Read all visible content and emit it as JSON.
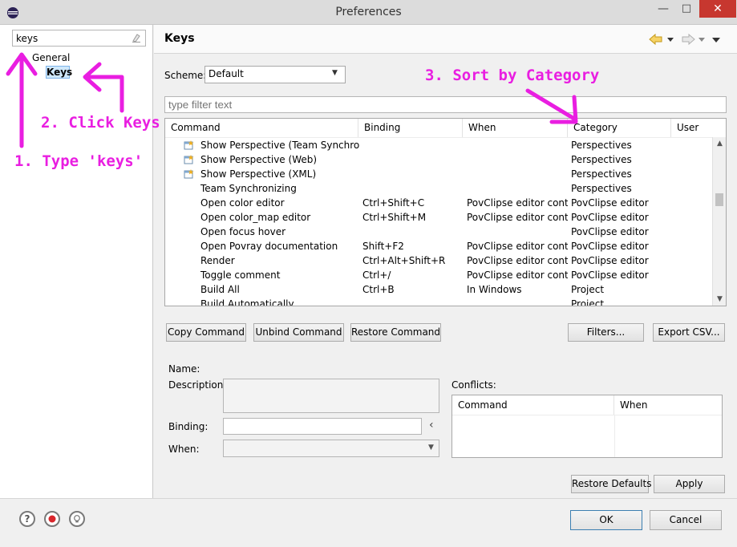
{
  "window": {
    "title": "Preferences",
    "minimize_glyph": "—",
    "maximize_glyph": "□",
    "close_glyph": "✕",
    "close_color": "#c7372f"
  },
  "nav": {
    "filter_value": "keys",
    "clear_icon": "clear-icon",
    "tree": {
      "general": "General",
      "keys": "Keys"
    }
  },
  "page": {
    "title": "Keys",
    "nav_icons": [
      "back-icon",
      "back-menu-icon",
      "forward-icon",
      "forward-menu-icon",
      "view-menu-icon"
    ]
  },
  "scheme": {
    "label": "Scheme:",
    "value": "Default"
  },
  "filter": {
    "placeholder": "type filter text"
  },
  "table": {
    "columns": [
      "Command",
      "Binding",
      "When",
      "Category",
      "User"
    ],
    "sort_indicator": "˄",
    "rows": [
      {
        "icon": true,
        "command": "Show Perspective (Team Synchronizing)",
        "binding": "",
        "when": "",
        "category": "Perspectives"
      },
      {
        "icon": true,
        "command": "Show Perspective (Web)",
        "binding": "",
        "when": "",
        "category": "Perspectives"
      },
      {
        "icon": true,
        "command": "Show Perspective (XML)",
        "binding": "",
        "when": "",
        "category": "Perspectives"
      },
      {
        "icon": false,
        "command": "Team Synchronizing",
        "binding": "",
        "when": "",
        "category": "Perspectives"
      },
      {
        "icon": false,
        "command": "Open color editor",
        "binding": "Ctrl+Shift+C",
        "when": "PovClipse editor context",
        "category": "PovClipse editor"
      },
      {
        "icon": false,
        "command": "Open color_map editor",
        "binding": "Ctrl+Shift+M",
        "when": "PovClipse editor context",
        "category": "PovClipse editor"
      },
      {
        "icon": false,
        "command": "Open focus hover",
        "binding": "",
        "when": "",
        "category": "PovClipse editor"
      },
      {
        "icon": false,
        "command": "Open Povray documentation",
        "binding": "Shift+F2",
        "when": "PovClipse editor context",
        "category": "PovClipse editor"
      },
      {
        "icon": false,
        "command": "Render",
        "binding": "Ctrl+Alt+Shift+R",
        "when": "PovClipse editor context",
        "category": "PovClipse editor"
      },
      {
        "icon": false,
        "command": "Toggle comment",
        "binding": "Ctrl+/",
        "when": "PovClipse editor context",
        "category": "PovClipse editor"
      },
      {
        "icon": false,
        "command": "Build All",
        "binding": "Ctrl+B",
        "when": "In Windows",
        "category": "Project"
      },
      {
        "icon": false,
        "command": "Build Automatically",
        "binding": "",
        "when": "",
        "category": "Project"
      }
    ]
  },
  "buttons": {
    "copy_command": "Copy Command",
    "unbind_command": "Unbind Command",
    "restore_command": "Restore Command",
    "filters": "Filters...",
    "export_csv": "Export CSV...",
    "restore_defaults": "Restore Defaults",
    "apply": "Apply",
    "ok": "OK",
    "cancel": "Cancel"
  },
  "details": {
    "name_label": "Name:",
    "description_label": "Description:",
    "binding_label": "Binding:",
    "when_label": "When:",
    "conflicts_label": "Conflicts:",
    "conflicts_columns": [
      "Command",
      "When"
    ],
    "binding_menu_glyph": "‹"
  },
  "footer": {
    "icons": [
      "help-icon",
      "record-macro-icon",
      "tip-icon"
    ],
    "help_glyph": "?"
  },
  "annotations": {
    "step1": "1. Type 'keys'",
    "step2": "2. Click Keys",
    "step3": "3. Sort by Category",
    "color": "#e91ee1"
  }
}
